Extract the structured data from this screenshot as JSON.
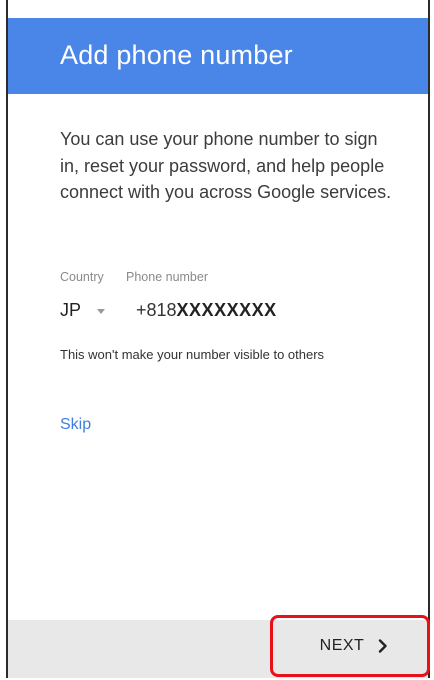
{
  "header": {
    "title": "Add phone number"
  },
  "body": {
    "description": "You can use your phone number to sign in, reset your password, and help people connect with you across Google services."
  },
  "form": {
    "country_label": "Country",
    "phone_label": "Phone number",
    "country_value": "JP",
    "phone_prefix": "+818",
    "phone_digits": "XXXXXXXX",
    "visibility_note": "This won't make your number visible to others"
  },
  "actions": {
    "skip_label": "Skip",
    "next_label": "NEXT"
  },
  "colors": {
    "header": "#4a86e8",
    "link": "#3f7de1",
    "highlight": "#e8111a"
  },
  "icons": {
    "country_dropdown": "dropdown-triangle-icon",
    "next": "chevron-right-icon"
  }
}
